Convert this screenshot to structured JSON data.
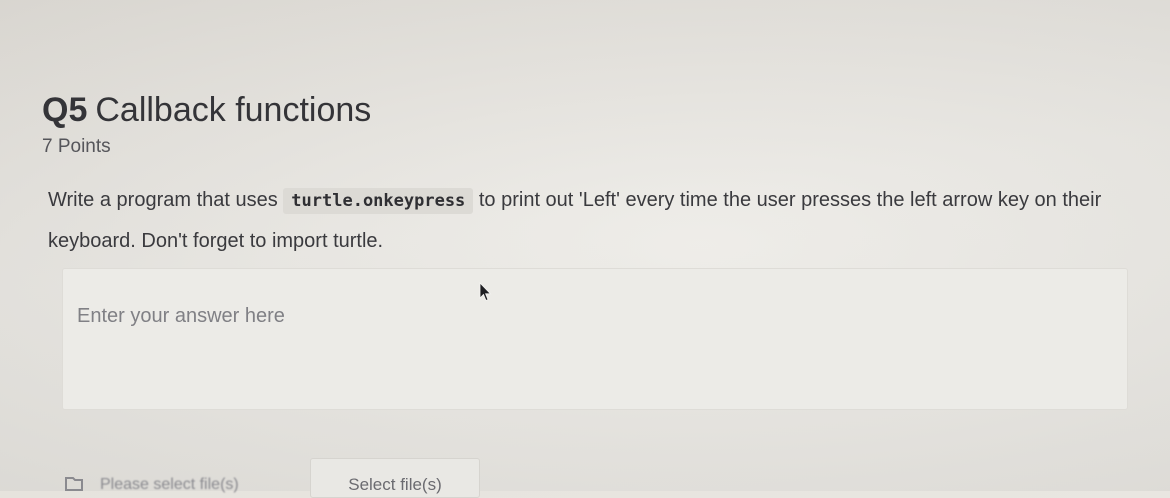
{
  "question": {
    "number": "Q5",
    "title": "Callback functions",
    "points": "7 Points",
    "prompt_before": "Write a program that uses ",
    "prompt_code": "turtle.onkeypress",
    "prompt_after": " to print out 'Left' every time the user presses the left arrow key on their keyboard.  Don't forget to import turtle."
  },
  "answer": {
    "placeholder": "Enter your answer here",
    "value": ""
  },
  "upload": {
    "status_text": "Please select file(s)",
    "button_label": "Select file(s)"
  },
  "icons": {
    "cursor": "mouse-pointer-icon",
    "file": "file-icon"
  },
  "colors": {
    "background": "#e8e6e1",
    "answer_box": "#ecebe7",
    "code_background": "#dcdad5"
  }
}
